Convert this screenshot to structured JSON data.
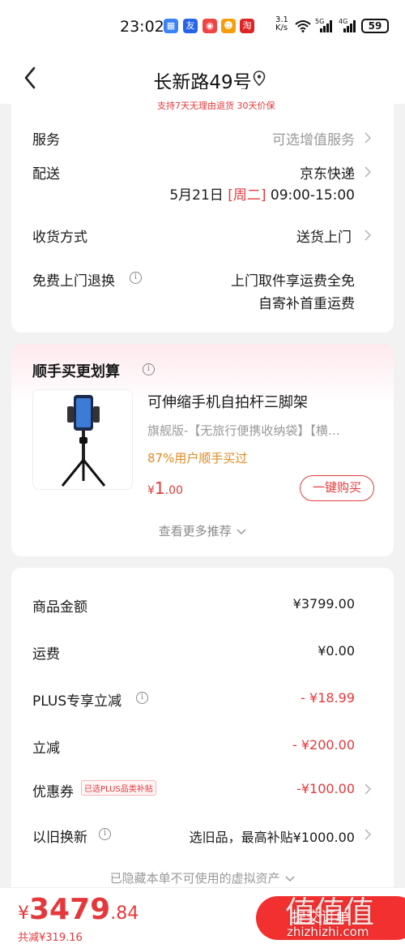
{
  "status_bar": {
    "time": "23:02",
    "app_icons": [
      "app-icon-1",
      "app-icon-2",
      "app-icon-3",
      "app-icon-4",
      "app-icon-5"
    ],
    "net_speed": "3.1",
    "net_unit": "K/s",
    "signal_1": "5G",
    "signal_2": "4G",
    "battery": "59"
  },
  "nav": {
    "title": "长新路49号"
  },
  "order_info": {
    "banner": "支持7天无理由退货 30天价保",
    "service_label": "服务",
    "service_value": "可选增值服务",
    "delivery_label": "配送",
    "delivery_value": "京东快递",
    "delivery_date": "5月21日",
    "delivery_weekday": "[周二]",
    "delivery_time": "09:00-15:00",
    "receive_label": "收货方式",
    "receive_value": "送货上门",
    "return_label": "免费上门退换",
    "return_value_1": "上门取件享运费全免",
    "return_value_2": "自寄补首重运费"
  },
  "addon": {
    "title": "顺手买更划算",
    "product_name": "可伸缩手机自拍杆三脚架",
    "product_spec": "旗舰版-【无旅行便携收纳袋】【横…",
    "bought_ratio": "87%用户顺手买过",
    "price_symbol": "¥",
    "price_int": "1",
    "price_dec": ".00",
    "buy_label": "一键购买",
    "more_label": "查看更多推荐"
  },
  "price_detail": {
    "items": [
      {
        "label": "商品金额",
        "value": "¥3799.00"
      },
      {
        "label": "运费",
        "value": "¥0.00"
      },
      {
        "label": "PLUS专享立减",
        "value": "- ¥18.99"
      },
      {
        "label": "立减",
        "value": "- ¥200.00"
      },
      {
        "label": "优惠券",
        "value": "-¥100.00"
      },
      {
        "label": "以旧换新",
        "value": "选旧品，最高补贴¥1000.00"
      }
    ],
    "coupon_tag": "已选PLUS品类补贴",
    "hidden_note": "已隐藏本单不可使用的虚拟资产"
  },
  "bottom": {
    "symbol": "¥",
    "total_int": "3479",
    "total_dec": ".84",
    "saved": "共减¥319.16",
    "submit_label": "提交订单"
  },
  "watermark": {
    "logo": "值值值",
    "site": "zhizhizhi.com"
  },
  "colors": {
    "accent": "#e4393c",
    "orange": "#e08a1e",
    "submit_bg": "#f23030"
  }
}
